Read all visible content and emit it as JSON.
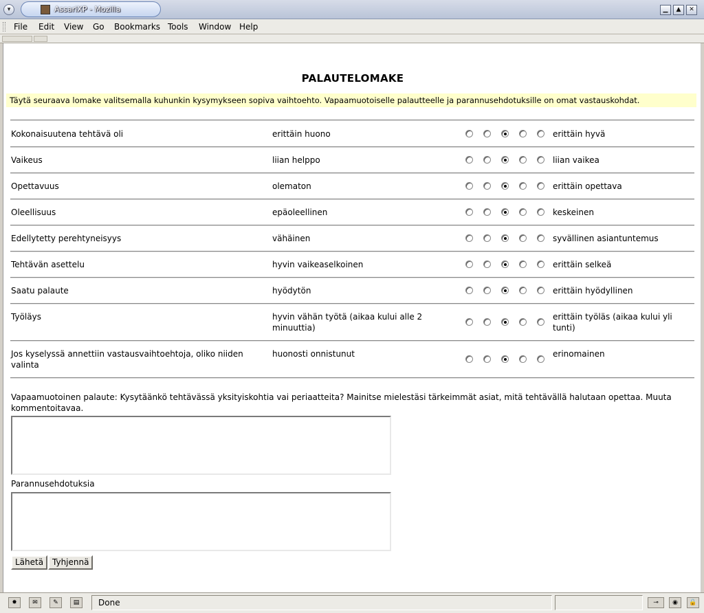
{
  "window": {
    "title": "AssariXP - Mozilla"
  },
  "menubar": {
    "items": [
      {
        "label": "File"
      },
      {
        "label": "Edit"
      },
      {
        "label": "View"
      },
      {
        "label": "Go"
      },
      {
        "label": "Bookmarks"
      },
      {
        "label": "Tools"
      },
      {
        "label": "Window"
      },
      {
        "label": "Help"
      }
    ]
  },
  "page": {
    "title": "PALAUTELOMAKE",
    "instructions": "Täytä seuraava lomake valitsemalla kuhunkin kysymykseen sopiva vaihtoehto. Vapaamuotoiselle palautteelle ja parannusehdotuksille on omat vastauskohdat.",
    "questions": [
      {
        "label": "Kokonaisuutena tehtävä oli",
        "low": "erittäin huono",
        "high": "erittäin hyvä",
        "selected": 3
      },
      {
        "label": "Vaikeus",
        "low": "liian helppo",
        "high": "liian vaikea",
        "selected": 3
      },
      {
        "label": "Opettavuus",
        "low": "olematon",
        "high": "erittäin opettava",
        "selected": 3
      },
      {
        "label": "Oleellisuus",
        "low": "epäoleellinen",
        "high": "keskeinen",
        "selected": 3
      },
      {
        "label": "Edellytetty perehtyneisyys",
        "low": "vähäinen",
        "high": "syvällinen asiantuntemus",
        "selected": 3
      },
      {
        "label": "Tehtävän asettelu",
        "low": "hyvin vaikeaselkoinen",
        "high": "erittäin selkeä",
        "selected": 3
      },
      {
        "label": "Saatu palaute",
        "low": "hyödytön",
        "high": "erittäin hyödyllinen",
        "selected": 3
      },
      {
        "label": "Työläys",
        "low": "hyvin vähän työtä (aikaa kului alle 2 minuuttia)",
        "high": "erittäin työläs (aikaa kului yli tunti)",
        "selected": 3
      },
      {
        "label": "Jos kyselyssä annettiin vastausvaihtoehtoja, oliko niiden valinta",
        "low": "huonosti onnistunut",
        "high": "erinomainen",
        "selected": 3
      }
    ],
    "free_feedback_label": "Vapaamuotoinen palaute: Kysytäänkö tehtävässä yksityiskohtia vai periaatteita? Mainitse mielestäsi tärkeimmät asiat, mitä tehtävällä halutaan opettaa. Muuta kommentoitavaa.",
    "free_feedback_value": "",
    "improvements_label": "Parannusehdotuksia",
    "improvements_value": "",
    "submit_label": "Lähetä",
    "reset_label": "Tyhjennä"
  },
  "statusbar": {
    "text": "Done"
  }
}
